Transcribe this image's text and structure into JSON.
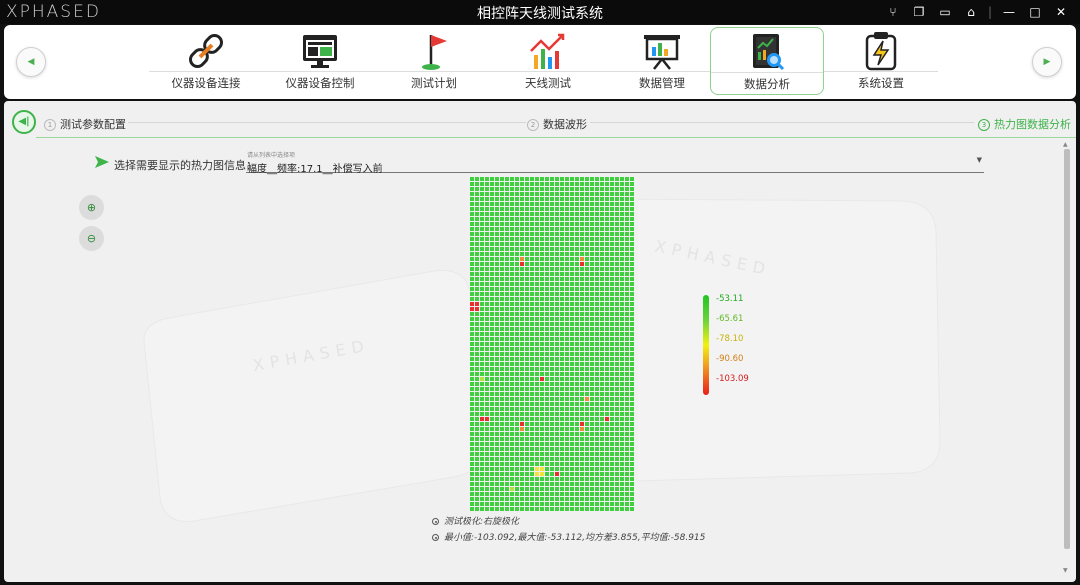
{
  "titlebar": {
    "logo": "XPHASED",
    "title": "相控阵天线测试系统",
    "controls": {
      "branch": "⑂",
      "restore": "❐",
      "monitor": "▭",
      "home": "⌂",
      "sep": "|",
      "minimize": "—",
      "maximize": "□",
      "close": "✕"
    }
  },
  "nav": {
    "prev": "◀",
    "next": "▶",
    "items": [
      {
        "label": "仪器设备连接",
        "icon": "link-icon"
      },
      {
        "label": "仪器设备控制",
        "icon": "monitor-control-icon"
      },
      {
        "label": "测试计划",
        "icon": "flag-icon"
      },
      {
        "label": "天线测试",
        "icon": "trend-chart-icon"
      },
      {
        "label": "数据管理",
        "icon": "presentation-board-icon"
      },
      {
        "label": "数据分析",
        "icon": "data-analysis-icon",
        "active": true
      },
      {
        "label": "系统设置",
        "icon": "lightning-clipboard-icon"
      }
    ]
  },
  "steps": {
    "back": "◀|",
    "items": [
      {
        "num": "1",
        "label": "测试参数配置"
      },
      {
        "num": "2",
        "label": "数据波形"
      },
      {
        "num": "3",
        "label": "热力图数据分析",
        "active": true
      }
    ]
  },
  "selector": {
    "label": "选择需要显示的热力图信息：",
    "placeholder": "请从列表中选择项",
    "value": "幅度__频率:17.1__补偿写入前"
  },
  "zoom": {
    "in": "⊕",
    "out": "⊖"
  },
  "heatmap": {
    "rows": 67,
    "cols": 33,
    "hotspots": [
      {
        "r": 16,
        "c": 10,
        "level": "orange"
      },
      {
        "r": 17,
        "c": 10,
        "level": "red"
      },
      {
        "r": 16,
        "c": 22,
        "level": "orange"
      },
      {
        "r": 17,
        "c": 22,
        "level": "red"
      },
      {
        "r": 25,
        "c": 0,
        "level": "red"
      },
      {
        "r": 26,
        "c": 0,
        "level": "red"
      },
      {
        "r": 25,
        "c": 1,
        "level": "red"
      },
      {
        "r": 26,
        "c": 1,
        "level": "red"
      },
      {
        "r": 40,
        "c": 14,
        "level": "red"
      },
      {
        "r": 44,
        "c": 23,
        "level": "orange"
      },
      {
        "r": 48,
        "c": 27,
        "level": "red"
      },
      {
        "r": 48,
        "c": 2,
        "level": "red"
      },
      {
        "r": 48,
        "c": 3,
        "level": "red"
      },
      {
        "r": 49,
        "c": 10,
        "level": "red"
      },
      {
        "r": 50,
        "c": 10,
        "level": "orange"
      },
      {
        "r": 49,
        "c": 22,
        "level": "red"
      },
      {
        "r": 50,
        "c": 22,
        "level": "orange"
      },
      {
        "r": 58,
        "c": 13,
        "level": "yellow"
      },
      {
        "r": 59,
        "c": 13,
        "level": "yellow"
      },
      {
        "r": 58,
        "c": 14,
        "level": "yellow"
      },
      {
        "r": 59,
        "c": 14,
        "level": "yellow"
      },
      {
        "r": 59,
        "c": 17,
        "level": "red"
      },
      {
        "r": 62,
        "c": 8,
        "level": "yellowgreen"
      },
      {
        "r": 40,
        "c": 2,
        "level": "yellowgreen"
      }
    ]
  },
  "legend": {
    "labels": [
      "-53.11",
      "-65.61",
      "-78.10",
      "-90.60",
      "-103.09"
    ],
    "colors": [
      "#22a822",
      "#62b82a",
      "#c6b20c",
      "#d2801a",
      "#d41c1c"
    ]
  },
  "info": {
    "polarization": "测试极化:右旋极化",
    "stats": "最小值:-103.092,最大值:-53.112,均方差3.855,平均值:-58.915"
  },
  "colors": {
    "accent": "#3db34a",
    "cell_green": "#3fcf3f",
    "cell_yellowgreen": "#b8e23a",
    "cell_yellow": "#f2e23a",
    "cell_orange": "#f08a3a",
    "cell_red": "#e82e2e"
  }
}
